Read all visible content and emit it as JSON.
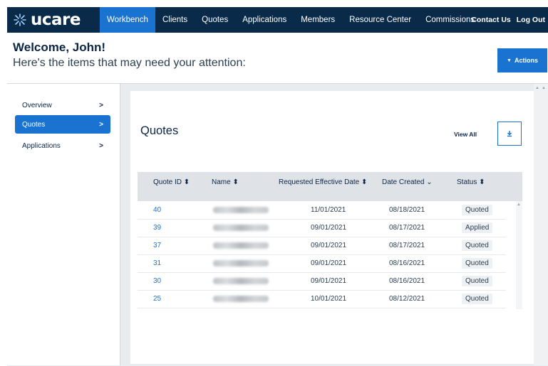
{
  "brand": {
    "name": "ucare"
  },
  "nav": {
    "items": [
      "Workbench",
      "Clients",
      "Quotes",
      "Applications",
      "Members",
      "Resource Center",
      "Commissions"
    ],
    "active_index": 0,
    "right": [
      "Contact Us",
      "Log Out"
    ]
  },
  "header": {
    "welcome": "Welcome, John!",
    "subtitle": "Here's the items that may need your attention:",
    "actions_label": "Actions"
  },
  "sidebar": {
    "items": [
      {
        "label": "Overview"
      },
      {
        "label": "Quotes"
      },
      {
        "label": "Applications"
      }
    ],
    "active_index": 1
  },
  "panel": {
    "title": "Quotes",
    "view_all": "View All",
    "download_icon": "download-icon"
  },
  "table": {
    "columns": [
      "Quote ID",
      "Name",
      "Requested Effective Date",
      "Date Created",
      "Status"
    ],
    "rows": [
      {
        "id": "40",
        "effective": "11/01/2021",
        "created": "08/18/2021",
        "status": "Quoted"
      },
      {
        "id": "39",
        "effective": "09/01/2021",
        "created": "08/17/2021",
        "status": "Applied"
      },
      {
        "id": "37",
        "effective": "09/01/2021",
        "created": "08/17/2021",
        "status": "Quoted"
      },
      {
        "id": "31",
        "effective": "09/01/2021",
        "created": "08/16/2021",
        "status": "Quoted"
      },
      {
        "id": "30",
        "effective": "09/01/2021",
        "created": "08/16/2021",
        "status": "Quoted"
      },
      {
        "id": "25",
        "effective": "10/01/2021",
        "created": "08/12/2021",
        "status": "Quoted"
      }
    ]
  },
  "colors": {
    "nav_bg": "#0a2a4a",
    "accent": "#1a73d1"
  }
}
